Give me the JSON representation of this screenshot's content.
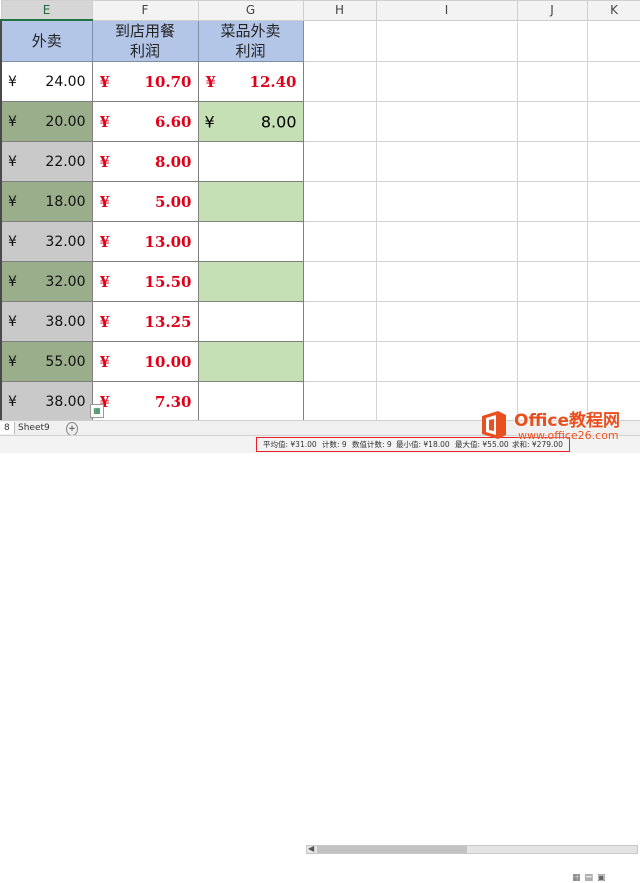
{
  "columns": [
    "E",
    "F",
    "G",
    "H",
    "I",
    "J",
    "K"
  ],
  "headers": {
    "e": "外卖",
    "f_line1": "到店用餐",
    "f_line2": "利润",
    "g_line1": "菜品外卖",
    "g_line2": "利润"
  },
  "currency_symbol": "¥",
  "rows": [
    {
      "e": "24.00",
      "f": "10.70",
      "g": "12.40"
    },
    {
      "e": "20.00",
      "f": "6.60",
      "g": "8.00"
    },
    {
      "e": "22.00",
      "f": "8.00",
      "g": ""
    },
    {
      "e": "18.00",
      "f": "5.00",
      "g": ""
    },
    {
      "e": "32.00",
      "f": "13.00",
      "g": ""
    },
    {
      "e": "32.00",
      "f": "15.50",
      "g": ""
    },
    {
      "e": "38.00",
      "f": "13.25",
      "g": ""
    },
    {
      "e": "55.00",
      "f": "10.00",
      "g": ""
    },
    {
      "e": "38.00",
      "f": "7.30",
      "g": ""
    }
  ],
  "sheet_tabs": {
    "partial": "8",
    "sheet9": "Sheet9",
    "add": "+"
  },
  "status": {
    "average": "平均值: ¥31.00",
    "count": "计数: 9",
    "numeric_count": "数值计数: 9",
    "min": "最小值: ¥18.00",
    "max": "最大值: ¥55.00",
    "sum": "求和: ¥279.00"
  },
  "logo": {
    "name": "Office教程网",
    "url": "www.office26.com"
  },
  "colors": {
    "header_blue": "#b4c6e7",
    "gray": "#c9c9c9",
    "dark_green": "#9bae8b",
    "light_green": "#c5e0b4",
    "red_text": "#e0001a",
    "status_highlight": "#e8202a",
    "logo_orange": "#e8501f"
  }
}
